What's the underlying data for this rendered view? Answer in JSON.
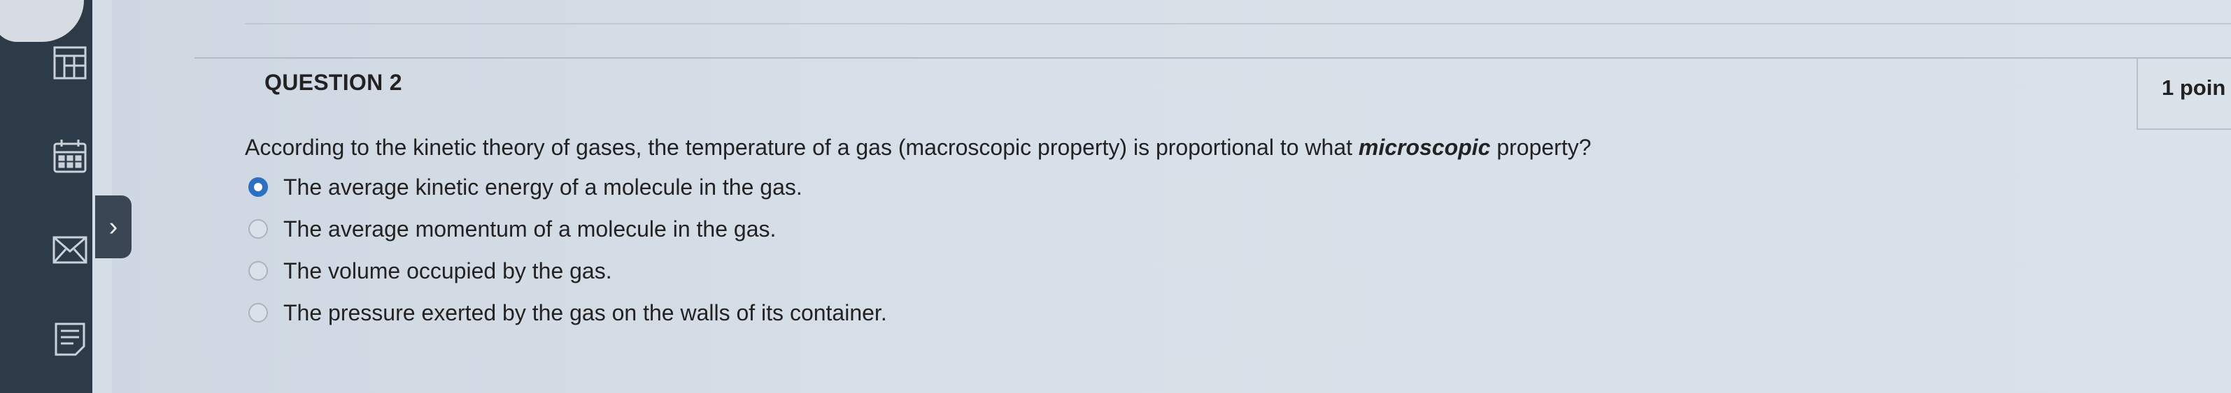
{
  "question": {
    "title": "QUESTION 2",
    "points": "1 poin",
    "prompt_before": "According to the kinetic theory of gases, the temperature of a gas (macroscopic property) is proportional to what ",
    "prompt_emphasis": "microscopic",
    "prompt_after": " property?",
    "options": [
      {
        "label": "The average kinetic energy of a molecule in the gas.",
        "selected": true
      },
      {
        "label": "The average momentum of a molecule in the gas.",
        "selected": false
      },
      {
        "label": "The volume occupied by the gas.",
        "selected": false
      },
      {
        "label": "The pressure exerted by the gas on the walls of its container.",
        "selected": false
      }
    ]
  },
  "nav": {
    "expander_symbol": "›",
    "icons": [
      "table-icon",
      "calendar-icon",
      "mail-icon",
      "document-icon"
    ]
  },
  "colors": {
    "rail": "#2d3a47",
    "accent": "#2d6fc1",
    "background": "#d5dde6"
  }
}
